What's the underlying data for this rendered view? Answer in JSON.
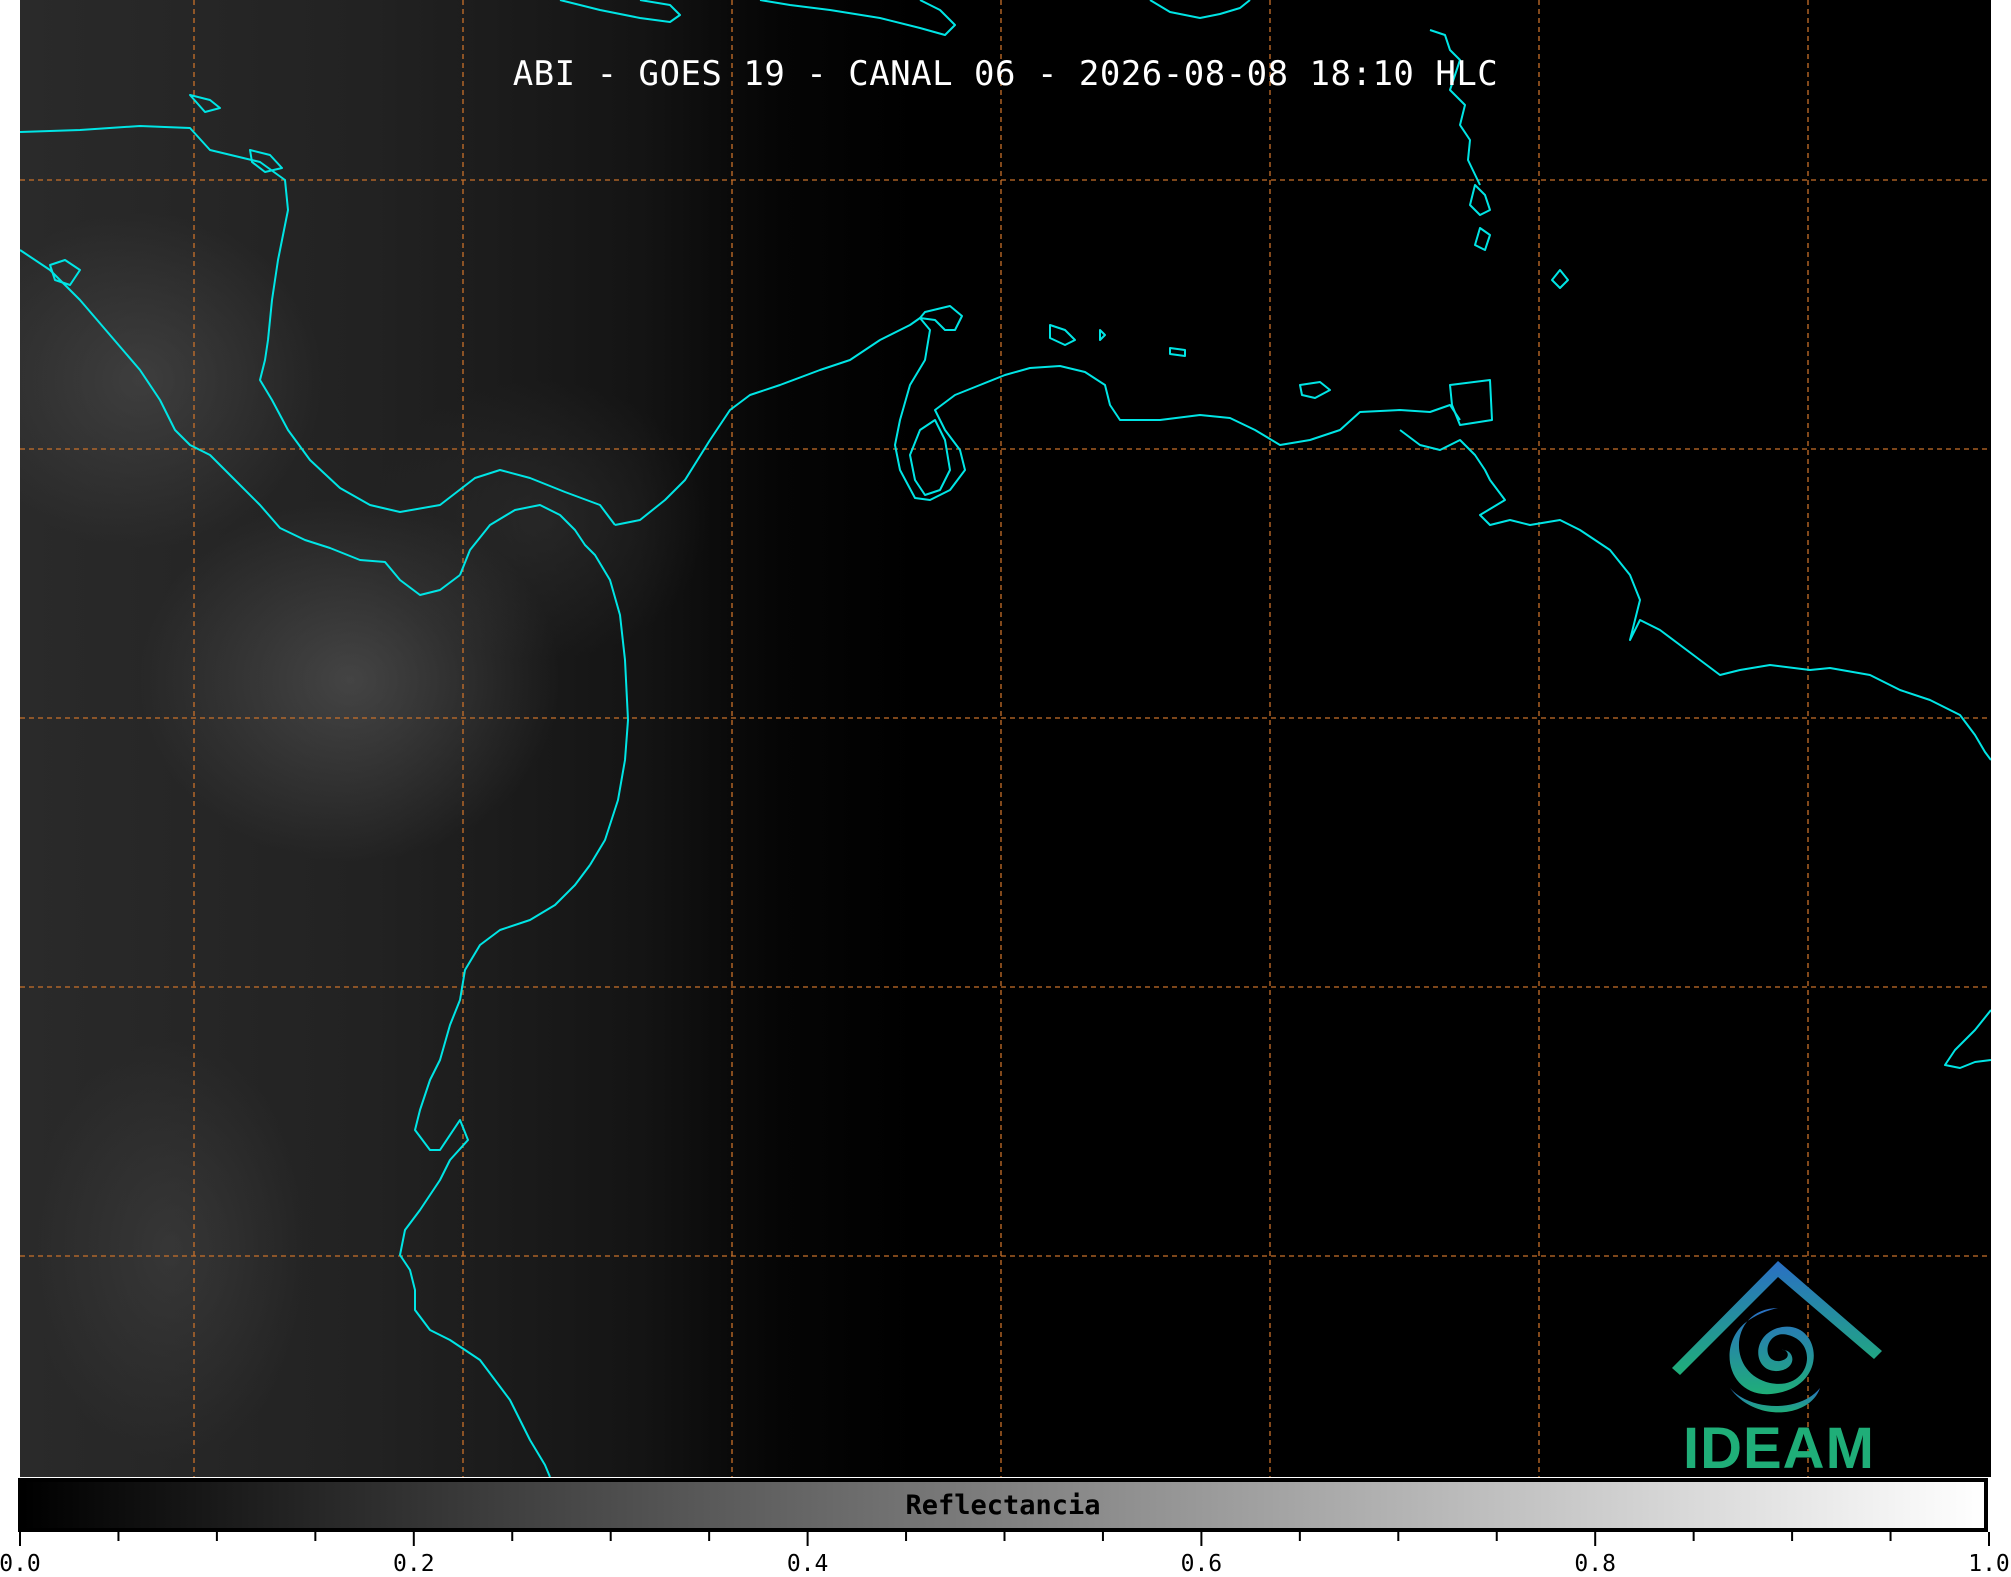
{
  "title": "ABI - GOES 19 - CANAL 06 - 2026-08-08 18:10 HLC",
  "logo": {
    "text": "IDEAM"
  },
  "colorbar": {
    "label": "Reflectancia",
    "min": 0.0,
    "max": 1.0,
    "tick_labels": [
      "0.0",
      "0.2",
      "0.4",
      "0.6",
      "0.8",
      "1.0"
    ],
    "colormap": "grayscale"
  },
  "colors": {
    "coastline": "#00e5e5",
    "graticule": "#c8702a",
    "logo_blue": "#2a78c0",
    "logo_green": "#1fae78"
  }
}
